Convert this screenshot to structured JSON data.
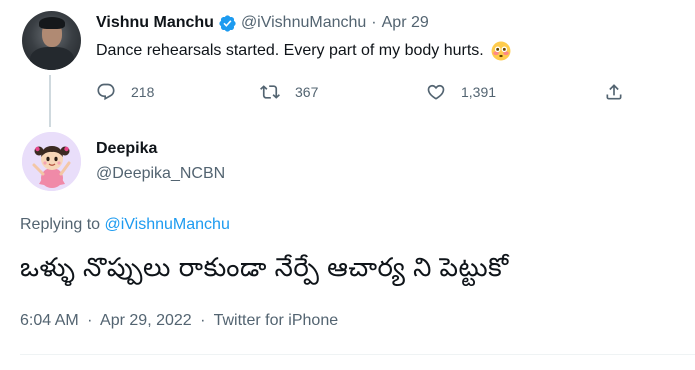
{
  "parent_tweet": {
    "author_name": "Vishnu Manchu",
    "verified": true,
    "handle": "@iVishnuManchu",
    "separator": "·",
    "date": "Apr 29",
    "text": "Dance rehearsals started. Every part of my body hurts.",
    "emoji": "flushed-face-emoji",
    "reply_count": "218",
    "retweet_count": "367",
    "like_count": "1,391"
  },
  "main_tweet": {
    "author_name": "Deepika",
    "handle": "@Deepika_NCBN",
    "replying_prefix": "Replying to",
    "replying_mention": "@iVishnuManchu",
    "text": "ఒళ్ళు నొప్పులు రాకుండా నేర్పే ఆచార్య ని పెట్టుకో",
    "time": "6:04 AM",
    "date": "Apr 29, 2022",
    "separator": "·",
    "source": "Twitter for iPhone"
  },
  "colors": {
    "accent": "#1d9bf0",
    "text_primary": "#0f1419",
    "text_secondary": "#536471"
  }
}
